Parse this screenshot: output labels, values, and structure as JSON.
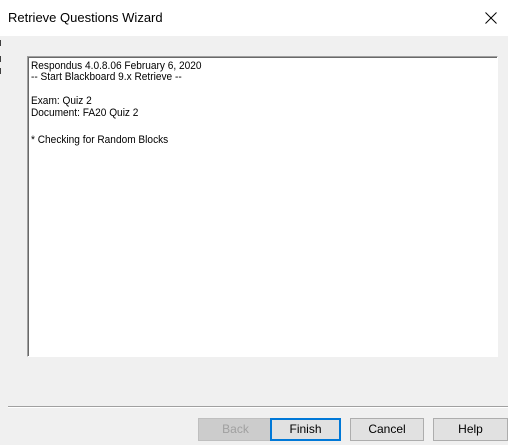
{
  "window": {
    "title": "Retrieve Questions Wizard",
    "close_symbol": "×"
  },
  "log": {
    "lines": [
      "Respondus 4.0.8.06  February 6, 2020",
      "-- Start Blackboard 9.x Retrieve --",
      "",
      "Exam: Quiz 2",
      "Document: FA20 Quiz 2",
      "",
      "* Checking for Random Blocks"
    ]
  },
  "buttons": {
    "back": "Back",
    "finish": "Finish",
    "cancel": "Cancel",
    "help": "Help"
  },
  "icons": {
    "close": "close-icon"
  },
  "colors": {
    "window_bg": "#f0f0f0",
    "accent_border": "#0078d7",
    "disabled_text": "#a0a0a0"
  }
}
